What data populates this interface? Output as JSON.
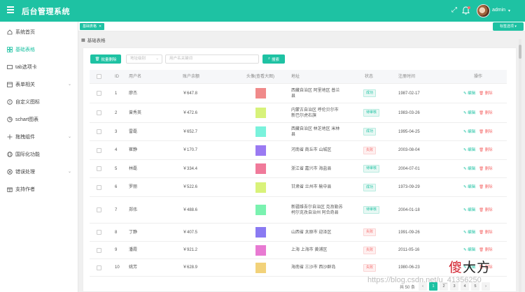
{
  "header": {
    "title": "后台管理系统",
    "username": "admin"
  },
  "sidebar": {
    "items": [
      {
        "label": "系统首页",
        "icon": "home-icon"
      },
      {
        "label": "基础表格",
        "icon": "grid-icon",
        "active": true
      },
      {
        "label": "tab选项卡",
        "icon": "tab-icon"
      },
      {
        "label": "表单相关",
        "icon": "calendar-icon",
        "expandable": true
      },
      {
        "label": "自定义图标",
        "icon": "warning-icon"
      },
      {
        "label": "schart图表",
        "icon": "chart-icon"
      },
      {
        "label": "拖拽组件",
        "icon": "drag-icon",
        "expandable": true
      },
      {
        "label": "国际化功能",
        "icon": "globe-icon"
      },
      {
        "label": "错误处理",
        "icon": "error-icon",
        "expandable": true
      },
      {
        "label": "支持作者",
        "icon": "gift-icon"
      }
    ]
  },
  "tags": {
    "open_tab": "基础表格",
    "options_label": "标签选项"
  },
  "breadcrumb": "基础表格",
  "toolbar": {
    "batch_delete": "批量删除",
    "address_placeholder": "地址级别",
    "keyword_placeholder": "用户名关键词",
    "search_label": "搜索"
  },
  "table": {
    "headers": [
      "ID",
      "用户名",
      "账户余额",
      "头像(查看大图)",
      "地址",
      "状态",
      "注册时间",
      "操作"
    ],
    "edit_label": "编辑",
    "delete_label": "删除",
    "rows": [
      {
        "id": "1",
        "name": "廖杰",
        "balance": "￥647.8",
        "avatar_color": "#f08a8a",
        "address": "西藏自治区 阿里地区 普兰县",
        "status": "成功",
        "status_type": "ok",
        "date": "1987-02-17"
      },
      {
        "id": "2",
        "name": "曾秀英",
        "balance": "￥472.6",
        "avatar_color": "#d7f27a",
        "address": "内蒙古自治区 呼伦贝尔市 新巴尔虎右旗",
        "status": "待审核",
        "status_type": "pend",
        "date": "1983-03-26"
      },
      {
        "id": "3",
        "name": "雷磊",
        "balance": "￥652.7",
        "avatar_color": "#7af2dc",
        "address": "西藏自治区 林芝地区 米林县",
        "status": "成功",
        "status_type": "ok",
        "date": "1995-04-25"
      },
      {
        "id": "4",
        "name": "崔静",
        "balance": "￥170.7",
        "avatar_color": "#9a7af2",
        "address": "河南省 商丘市 山城区",
        "status": "失败",
        "status_type": "fail",
        "date": "2003-08-04"
      },
      {
        "id": "5",
        "name": "林磊",
        "balance": "￥334.4",
        "avatar_color": "#f07a9a",
        "address": "浙江省 嘉兴市 海盐县",
        "status": "待审核",
        "status_type": "pend",
        "date": "2004-07-01"
      },
      {
        "id": "6",
        "name": "罗丽",
        "balance": "￥522.6",
        "avatar_color": "#d9f27a",
        "address": "甘肃省 兰州市 榆中县",
        "status": "成功",
        "status_type": "ok",
        "date": "1973-09-29"
      },
      {
        "id": "7",
        "name": "郑伟",
        "balance": "￥488.6",
        "avatar_color": "#7af2b0",
        "address": "新疆维吾尔自治区 克孜勒苏柯尔克孜自治州 阿合奇县",
        "status": "待审核",
        "status_type": "pend",
        "date": "2004-01-18"
      },
      {
        "id": "8",
        "name": "丁静",
        "balance": "￥407.5",
        "avatar_color": "#8a7af2",
        "address": "山西省 太原市 迎泽区",
        "status": "失败",
        "status_type": "fail",
        "date": "1991-09-26"
      },
      {
        "id": "9",
        "name": "潘霞",
        "balance": "￥921.2",
        "avatar_color": "#e87ad2",
        "address": "上海 上海市 黄浦区",
        "status": "失败",
        "status_type": "fail",
        "date": "2011-05-16"
      },
      {
        "id": "10",
        "name": "姚芳",
        "balance": "￥628.9",
        "avatar_color": "#f2d27a",
        "address": "海南省 三沙市 西沙群岛",
        "status": "失败",
        "status_type": "fail",
        "date": "1980-06-23"
      }
    ]
  },
  "pagination": {
    "total_label": "共 50 条",
    "pages": [
      "1",
      "2",
      "3",
      "4",
      "5"
    ],
    "current": "1",
    "prev": "‹",
    "next": "›"
  },
  "watermark": {
    "logo": "傻大方",
    "url": "https://blog.csdn.net/u_41356250"
  }
}
